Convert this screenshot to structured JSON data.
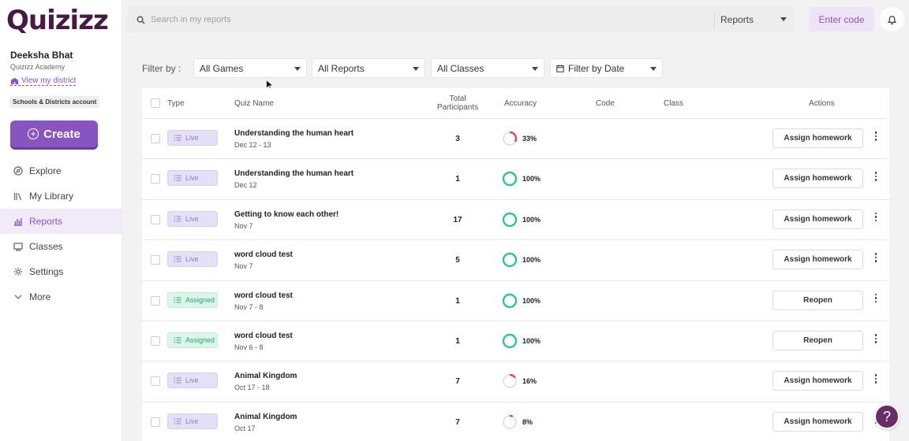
{
  "app": {
    "logo_text": "Quizizz"
  },
  "sidebar": {
    "user_name": "Deeksha Bhat",
    "user_org": "Quizizz Academy",
    "view_district": "View my district",
    "account_type": "Schools & Districts account",
    "create_label": "Create",
    "nav": [
      {
        "label": "Explore",
        "icon": "compass-icon",
        "active": false
      },
      {
        "label": "My Library",
        "icon": "library-icon",
        "active": false
      },
      {
        "label": "Reports",
        "icon": "reports-icon",
        "active": true
      },
      {
        "label": "Classes",
        "icon": "classes-icon",
        "active": false
      },
      {
        "label": "Settings",
        "icon": "gear-icon",
        "active": false
      },
      {
        "label": "More",
        "icon": "chevron-down-icon",
        "active": false
      }
    ]
  },
  "header": {
    "search_placeholder": "Search in my reports",
    "search_scope": "Reports",
    "enter_code": "Enter code"
  },
  "filters": {
    "label": "Filter by :",
    "games": "All Games",
    "reports": "All Reports",
    "classes": "All Classes",
    "date": "Filter by Date"
  },
  "table": {
    "headers": {
      "type": "Type",
      "quiz_name": "Quiz Name",
      "total_line1": "Total",
      "total_line2": "Participants",
      "accuracy": "Accuracy",
      "code": "Code",
      "class": "Class",
      "actions": "Actions"
    },
    "rows": [
      {
        "type": "Live",
        "kind": "live",
        "name": "Understanding the human heart",
        "date": "Dec 12 - 13",
        "participants": "3",
        "accuracy": "33%",
        "acc_value": 0.33,
        "action": "Assign homework"
      },
      {
        "type": "Live",
        "kind": "live",
        "name": "Understanding the human heart",
        "date": "Dec 12",
        "participants": "1",
        "accuracy": "100%",
        "acc_value": 1.0,
        "action": "Assign homework"
      },
      {
        "type": "Live",
        "kind": "live",
        "name": "Getting to know each other!",
        "date": "Nov 7",
        "participants": "17",
        "accuracy": "100%",
        "acc_value": 1.0,
        "action": "Assign homework"
      },
      {
        "type": "Live",
        "kind": "live",
        "name": "word cloud test",
        "date": "Nov 7",
        "participants": "5",
        "accuracy": "100%",
        "acc_value": 1.0,
        "action": "Assign homework"
      },
      {
        "type": "Assigned",
        "kind": "assigned",
        "name": "word cloud test",
        "date": "Nov 7 - 8",
        "participants": "1",
        "accuracy": "100%",
        "acc_value": 1.0,
        "action": "Reopen"
      },
      {
        "type": "Assigned",
        "kind": "assigned",
        "name": "word cloud test",
        "date": "Nov 6 - 8",
        "participants": "1",
        "accuracy": "100%",
        "acc_value": 1.0,
        "action": "Reopen"
      },
      {
        "type": "Live",
        "kind": "live",
        "name": "Animal Kingdom",
        "date": "Oct 17 - 18",
        "participants": "7",
        "accuracy": "16%",
        "acc_value": 0.16,
        "action": "Assign homework"
      },
      {
        "type": "Live",
        "kind": "live",
        "name": "Animal Kingdom",
        "date": "Oct 17",
        "participants": "7",
        "accuracy": "8%",
        "acc_value": 0.08,
        "action": "Assign homework"
      }
    ]
  },
  "help_label": "?",
  "colors": {
    "brand": "#8854c0",
    "logo": "#461a42",
    "accuracy_high": "#2fc396",
    "accuracy_low": "#e0446b",
    "ring_track": "#e2e2e2"
  }
}
